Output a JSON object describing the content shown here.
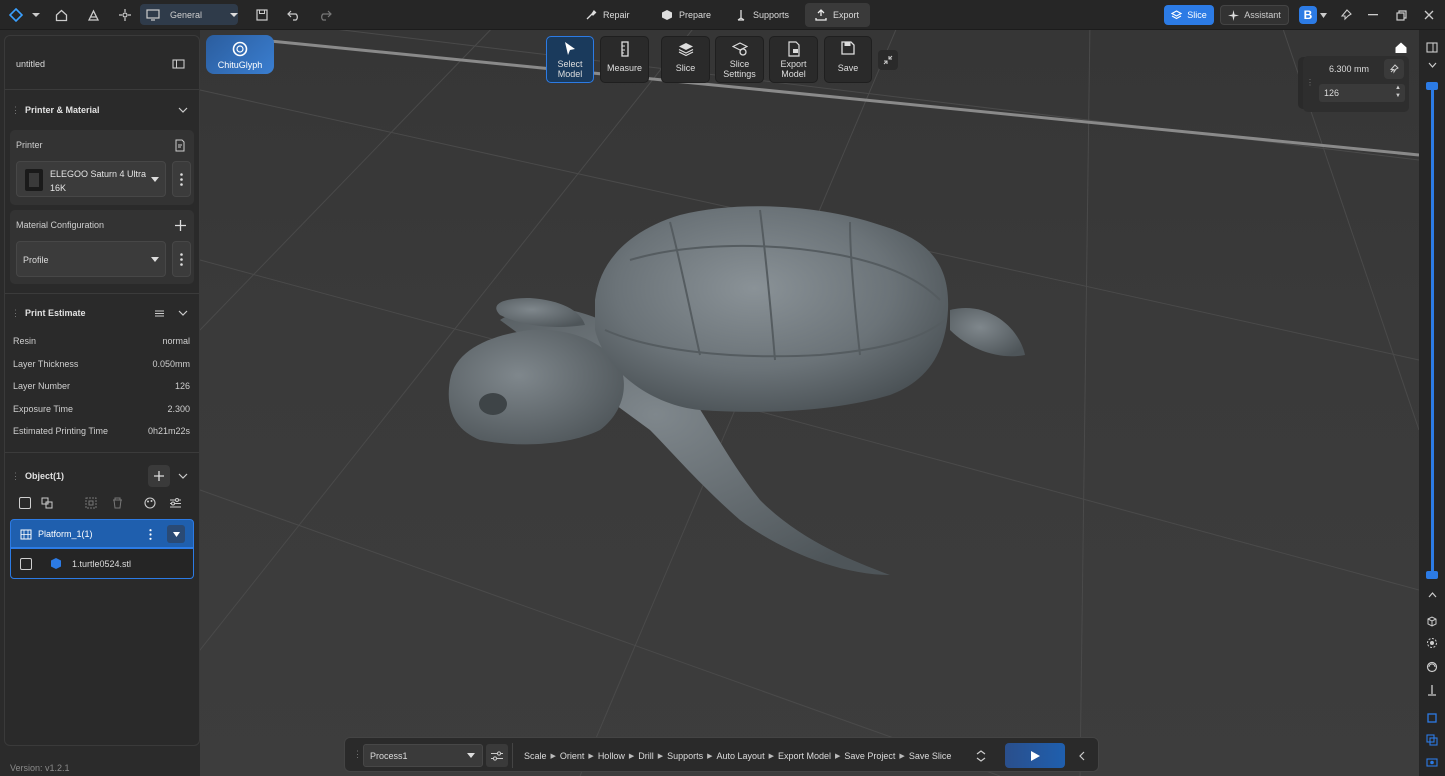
{
  "topbar": {
    "workspace": "General",
    "nav": [
      {
        "label": "Repair",
        "icon": "repair-icon"
      },
      {
        "label": "Prepare",
        "icon": "prepare-icon"
      },
      {
        "label": "Supports",
        "icon": "supports-icon"
      },
      {
        "label": "Export",
        "icon": "export-icon"
      }
    ],
    "slice_label": "Slice",
    "assistant_label": "Assistant"
  },
  "brand": {
    "name": "ChituGlyph"
  },
  "toolbar": {
    "select_model": "Select Model",
    "measure": "Measure",
    "slice": "Slice",
    "slice_settings": "Slice Settings",
    "export_model": "Export Model",
    "save": "Save"
  },
  "project": {
    "name": "untitled"
  },
  "printer_material": {
    "title": "Printer & Material",
    "printer_label": "Printer",
    "printer_name_line1": "ELEGOO Saturn 4 Ultra",
    "printer_name_line2": "16K",
    "material_label": "Material Configuration",
    "profile": "Profile"
  },
  "estimate": {
    "title": "Print Estimate",
    "rows": [
      {
        "label": "Resin",
        "value": "normal"
      },
      {
        "label": "Layer Thickness",
        "value": "0.050mm"
      },
      {
        "label": "Layer Number",
        "value": "126"
      },
      {
        "label": "Exposure Time",
        "value": "2.300"
      },
      {
        "label": "Estimated Printing Time",
        "value": "0h21m22s"
      }
    ]
  },
  "objects": {
    "title": "Object(1)",
    "platform": "Platform_1(1)",
    "file": "1.turtle0524.stl"
  },
  "layer_panel": {
    "height": "6.300 mm",
    "layer": "126"
  },
  "bottom": {
    "process": "Process1",
    "steps": [
      "Scale",
      "Orient",
      "Hollow",
      "Drill",
      "Supports",
      "Auto Layout",
      "Export Model",
      "Save Project",
      "Save Slice"
    ]
  },
  "version": "Version: v1.2.1",
  "colors": {
    "accent": "#2c7be5",
    "selected": "#1f5fae"
  }
}
